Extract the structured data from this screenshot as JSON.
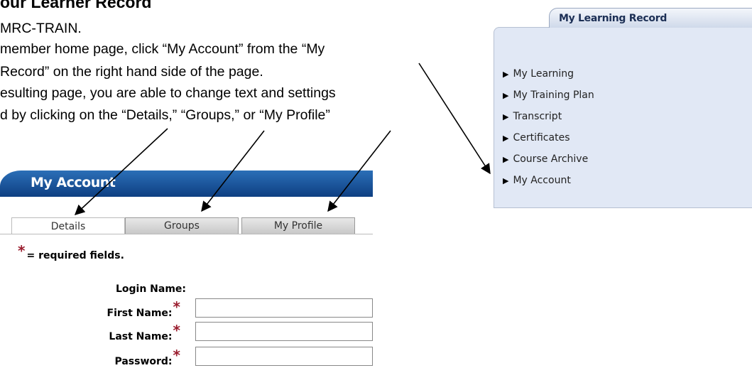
{
  "instructions": {
    "title": "our Learner Record",
    "lines": [
      "MRC-TRAIN.",
      "member home page, click “My Account” from the “My",
      " Record” on the right hand side of the page.",
      "esulting page, you are able to change text and settings",
      "d by clicking on the “Details,” “Groups,” or “My Profile”"
    ]
  },
  "learning_record": {
    "tab_label": "My Learning Record",
    "items": [
      "My Learning",
      "My Training Plan",
      "Transcript",
      "Certificates",
      "Course Archive",
      "My Account"
    ],
    "colors": {
      "panel": "#e1e8f5",
      "tab_text": "#1c2f55"
    }
  },
  "my_account": {
    "header": "My Account",
    "tabs": [
      "Details",
      "Groups",
      "My Profile"
    ],
    "active_tab": "Details",
    "required_note": "= required fields.",
    "required_marker": "*",
    "fields": [
      {
        "label": "Login Name:",
        "required": false,
        "value": ""
      },
      {
        "label": "First Name:",
        "required": true,
        "value": ""
      },
      {
        "label": "Last Name:",
        "required": true,
        "value": ""
      },
      {
        "label": "Password:",
        "required": true,
        "value": ""
      }
    ],
    "colors": {
      "header": "#0e3f82",
      "required_star": "#9a1d2e"
    }
  },
  "icons": {
    "list_bullet": "▶",
    "arrows": "annotation-arrow"
  }
}
